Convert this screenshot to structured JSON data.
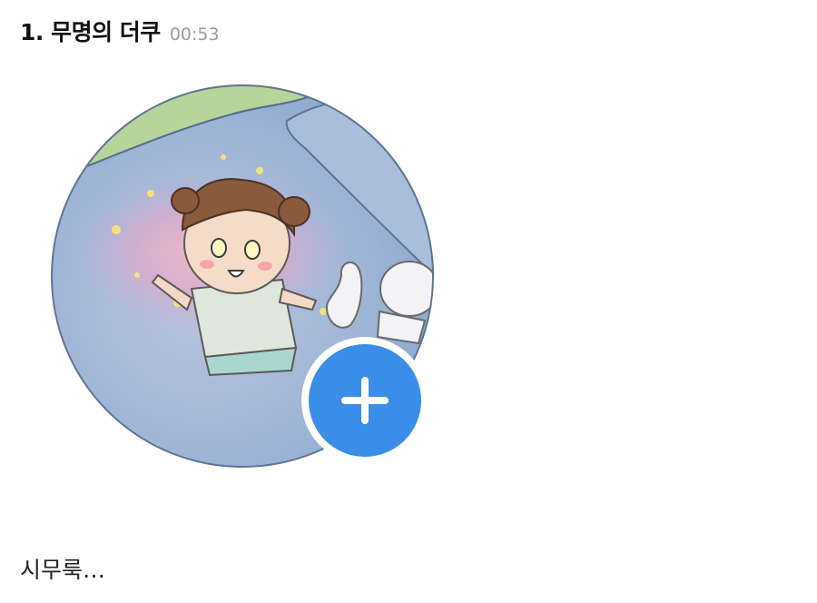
{
  "post": {
    "title": "1. 무명의 더쿠",
    "timestamp": "00:53",
    "body": "시무룩…"
  },
  "avatar": {
    "description_icon": "profile-photo",
    "accent_color": "#3a8ee8"
  },
  "add_button": {
    "icon": "plus-icon"
  }
}
